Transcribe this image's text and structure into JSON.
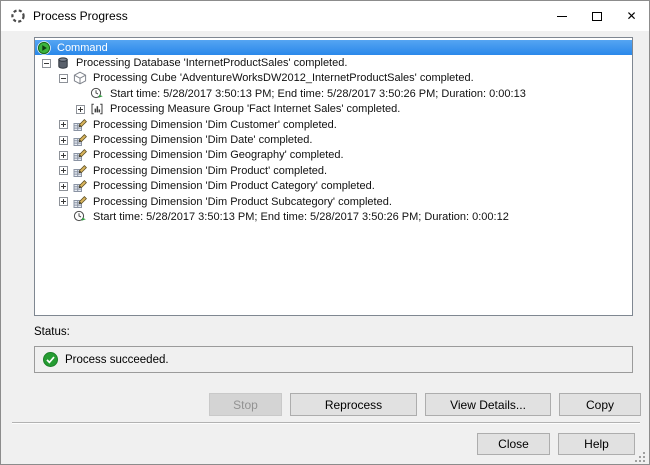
{
  "window": {
    "title": "Process Progress"
  },
  "tree": {
    "rows": [
      {
        "level": 0,
        "icon": "command",
        "expander": null,
        "selected": true,
        "label": "Command"
      },
      {
        "level": 1,
        "icon": "database",
        "expander": "minus",
        "selected": false,
        "label": "Processing Database 'InternetProductSales' completed."
      },
      {
        "level": 2,
        "icon": "cube",
        "expander": "minus",
        "selected": false,
        "label": "Processing Cube 'AdventureWorksDW2012_InternetProductSales' completed."
      },
      {
        "level": 3,
        "icon": "clock",
        "expander": null,
        "selected": false,
        "label": "Start time: 5/28/2017 3:50:13 PM; End time: 5/28/2017 3:50:26 PM; Duration: 0:00:13"
      },
      {
        "level": 3,
        "icon": "measure-group",
        "expander": "plus",
        "selected": false,
        "label": "Processing Measure Group 'Fact Internet Sales' completed."
      },
      {
        "level": 2,
        "icon": "dimension",
        "expander": "plus",
        "selected": false,
        "label": "Processing Dimension 'Dim Customer' completed."
      },
      {
        "level": 2,
        "icon": "dimension",
        "expander": "plus",
        "selected": false,
        "label": "Processing Dimension 'Dim Date' completed."
      },
      {
        "level": 2,
        "icon": "dimension",
        "expander": "plus",
        "selected": false,
        "label": "Processing Dimension 'Dim Geography' completed."
      },
      {
        "level": 2,
        "icon": "dimension",
        "expander": "plus",
        "selected": false,
        "label": "Processing Dimension 'Dim Product' completed."
      },
      {
        "level": 2,
        "icon": "dimension",
        "expander": "plus",
        "selected": false,
        "label": "Processing Dimension 'Dim Product Category' completed."
      },
      {
        "level": 2,
        "icon": "dimension",
        "expander": "plus",
        "selected": false,
        "label": "Processing Dimension 'Dim Product Subcategory' completed."
      },
      {
        "level": 2,
        "icon": "clock",
        "expander": null,
        "selected": false,
        "label": "Start time: 5/28/2017 3:50:13 PM; End time: 5/28/2017 3:50:26 PM; Duration: 0:00:12"
      }
    ]
  },
  "status": {
    "label": "Status:",
    "message": "Process succeeded."
  },
  "actions": {
    "stop": "Stop",
    "reprocess": "Reprocess",
    "view_details": "View Details...",
    "copy": "Copy",
    "close": "Close",
    "help": "Help"
  },
  "colors": {
    "dialog_bg": "#f0f0f0",
    "selection_top": "#55a5f2",
    "selection_bottom": "#2a88ea",
    "success_green": "#259c32"
  }
}
